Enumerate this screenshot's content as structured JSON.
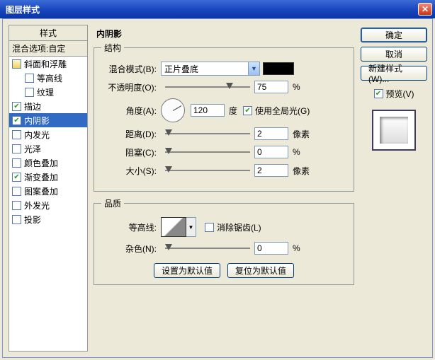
{
  "window": {
    "title": "图层样式"
  },
  "sidebar": {
    "header": "样式",
    "subheader": "混合选项:自定",
    "items": [
      {
        "label": "斜面和浮雕",
        "checked": false,
        "fancy": true
      },
      {
        "label": "等高线",
        "checked": false,
        "indent": true
      },
      {
        "label": "纹理",
        "checked": false,
        "indent": true
      },
      {
        "label": "描边",
        "checked": true
      },
      {
        "label": "内阴影",
        "checked": true,
        "selected": true
      },
      {
        "label": "内发光",
        "checked": false
      },
      {
        "label": "光泽",
        "checked": false
      },
      {
        "label": "颜色叠加",
        "checked": false
      },
      {
        "label": "渐变叠加",
        "checked": true
      },
      {
        "label": "图案叠加",
        "checked": false
      },
      {
        "label": "外发光",
        "checked": false
      },
      {
        "label": "投影",
        "checked": false
      }
    ]
  },
  "panel": {
    "title": "内阴影",
    "struct_legend": "结构",
    "quality_legend": "品质",
    "blend_mode_label": "混合模式(B):",
    "blend_mode_value": "正片叠底",
    "opacity_label": "不透明度(O):",
    "opacity_value": "75",
    "percent": "%",
    "angle_label": "角度(A):",
    "angle_value": "120",
    "angle_unit": "度",
    "global_light": "使用全局光(G)",
    "distance_label": "距离(D):",
    "distance_value": "2",
    "px": "像素",
    "choke_label": "阻塞(C):",
    "choke_value": "0",
    "size_label": "大小(S):",
    "size_value": "2",
    "contour_label": "等高线:",
    "antialias": "消除锯齿(L)",
    "noise_label": "杂色(N):",
    "noise_value": "0",
    "btn_default": "设置为默认值",
    "btn_reset": "复位为默认值"
  },
  "right": {
    "ok": "确定",
    "cancel": "取消",
    "new_style": "新建样式(W)...",
    "preview": "预览(V)"
  }
}
